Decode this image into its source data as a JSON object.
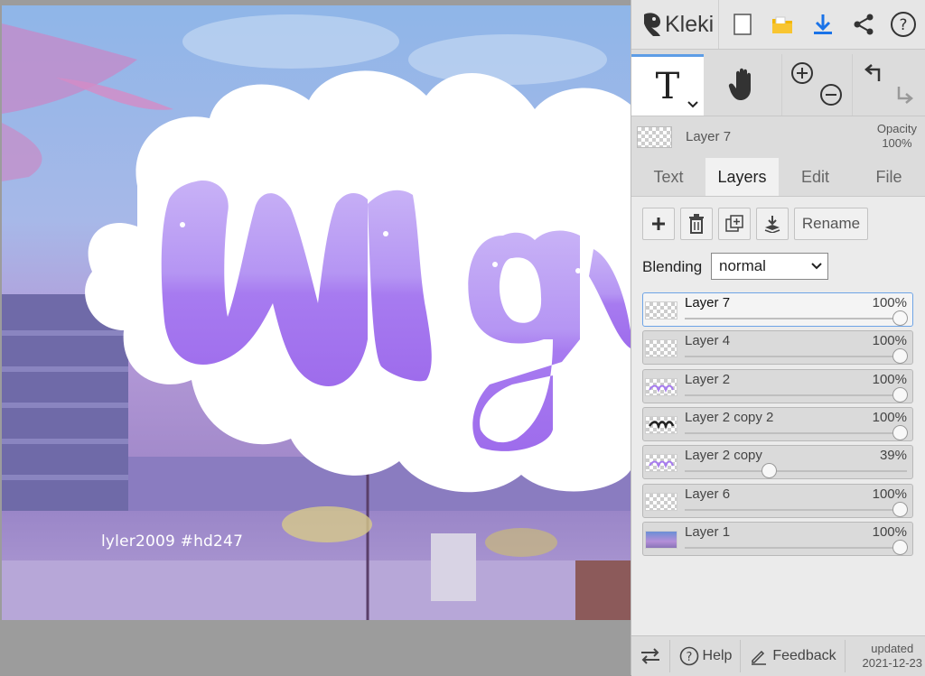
{
  "app": {
    "name": "Kleki"
  },
  "canvas": {
    "watermark": "lyler2009   #hd247"
  },
  "topbar": {
    "icons": [
      "kleki-logo-icon",
      "new-file-icon",
      "open-folder-icon",
      "download-icon",
      "share-icon",
      "help-icon"
    ]
  },
  "tools": {
    "text_tool_letter": "T",
    "active_tool": "text",
    "icons": [
      "text-tool-icon",
      "hand-tool-icon",
      "zoom-in-icon",
      "zoom-out-icon",
      "undo-icon",
      "redo-icon"
    ]
  },
  "current_layer": {
    "name": "Layer 7",
    "opacity_label": "Opacity",
    "opacity_value": "100%"
  },
  "tabs": [
    {
      "label": "Text",
      "active": false
    },
    {
      "label": "Layers",
      "active": true
    },
    {
      "label": "Edit",
      "active": false
    },
    {
      "label": "File",
      "active": false
    }
  ],
  "layer_actions": {
    "rename_label": "Rename"
  },
  "blending": {
    "label": "Blending",
    "value": "normal"
  },
  "layers": [
    {
      "name": "Layer 7",
      "opacity": "100%",
      "fraction": 1.0,
      "selected": true
    },
    {
      "name": "Layer 4",
      "opacity": "100%",
      "fraction": 1.0,
      "selected": false
    },
    {
      "name": "Layer 2",
      "opacity": "100%",
      "fraction": 1.0,
      "selected": false
    },
    {
      "name": "Layer 2 copy 2",
      "opacity": "100%",
      "fraction": 1.0,
      "selected": false
    },
    {
      "name": "Layer 2 copy",
      "opacity": "39%",
      "fraction": 0.39,
      "selected": false
    },
    {
      "name": "Layer 6",
      "opacity": "100%",
      "fraction": 1.0,
      "selected": false
    },
    {
      "name": "Layer 1",
      "opacity": "100%",
      "fraction": 1.0,
      "selected": false
    }
  ],
  "bottombar": {
    "help_label": "Help",
    "feedback_label": "Feedback",
    "updated_label": "updated",
    "updated_date": "2021-12-23"
  },
  "colors": {
    "accent": "#5d9de6",
    "download": "#1a73e8",
    "folder": "#f2b705",
    "lettering": "#a77bf0"
  }
}
